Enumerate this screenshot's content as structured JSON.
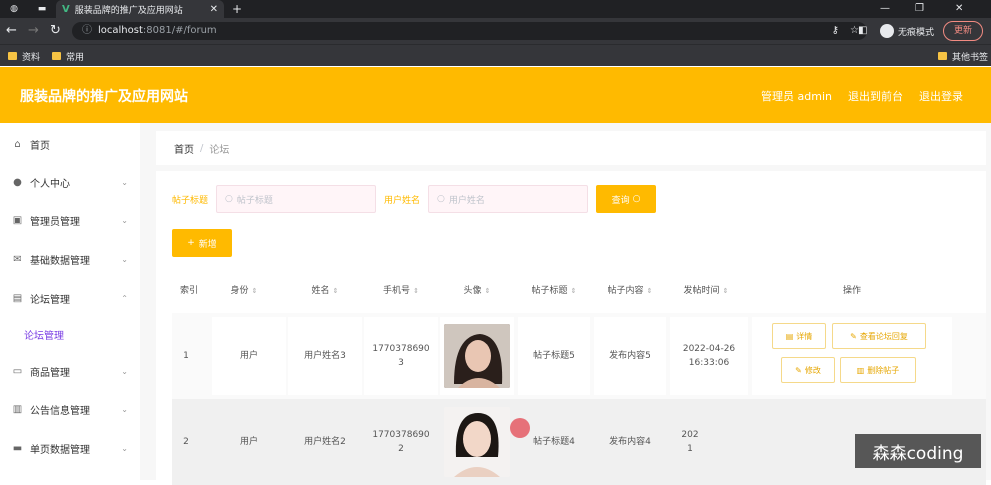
{
  "browser": {
    "tab_title": "服装品牌的推广及应用网站",
    "address": {
      "host": "localhost",
      "path": ":8081/#/forum"
    },
    "profile_label": "无痕模式",
    "update_label": "更新",
    "bookmarks": [
      "资料",
      "常用"
    ],
    "other_bookmarks": "其他书签"
  },
  "header": {
    "title": "服装品牌的推广及应用网站",
    "links": [
      "管理员 admin",
      "退出到前台",
      "退出登录"
    ]
  },
  "sidebar": {
    "items": [
      {
        "label": "首页",
        "icon": "home-icon",
        "arrow": false
      },
      {
        "label": "个人中心",
        "icon": "user-icon",
        "arrow": true
      },
      {
        "label": "管理员管理",
        "icon": "briefcase-icon",
        "arrow": true
      },
      {
        "label": "基础数据管理",
        "icon": "mail-icon",
        "arrow": true
      },
      {
        "label": "论坛管理",
        "icon": "document-icon",
        "arrow": true,
        "expanded": true
      },
      {
        "label": "论坛管理",
        "sub": true
      },
      {
        "label": "商品管理",
        "icon": "chat-icon",
        "arrow": true
      },
      {
        "label": "公告信息管理",
        "icon": "notice-icon",
        "arrow": true
      },
      {
        "label": "单页数据管理",
        "icon": "monitor-icon",
        "arrow": true
      }
    ]
  },
  "breadcrumb": {
    "home": "首页",
    "current": "论坛"
  },
  "search": {
    "title_label": "帖子标题",
    "title_placeholder": "帖子标题",
    "name_label": "用户姓名",
    "name_placeholder": "用户姓名",
    "query_label": "查询"
  },
  "add_label": "新增",
  "table": {
    "headers": [
      "索引",
      "身份",
      "姓名",
      "手机号",
      "头像",
      "帖子标题",
      "帖子内容",
      "发帖时间",
      "操作"
    ],
    "rows": [
      {
        "index": "1",
        "role": "用户",
        "name": "用户姓名3",
        "phone_a": "1770378690",
        "phone_b": "3",
        "title": "帖子标题5",
        "content": "发布内容5",
        "date": "2022-04-26",
        "time": "16:33:06"
      },
      {
        "index": "2",
        "role": "用户",
        "name": "用户姓名2",
        "phone_a": "1770378690",
        "phone_b": "2",
        "title": "帖子标题4",
        "content": "发布内容4",
        "date": "202",
        "time": "1"
      }
    ],
    "ops": [
      "详情",
      "查看论坛回复",
      "修改",
      "删除帖子"
    ]
  },
  "watermark": "森森coding",
  "colors": {
    "brand": "#ffba00",
    "active_menu": "#7b3fe4"
  }
}
